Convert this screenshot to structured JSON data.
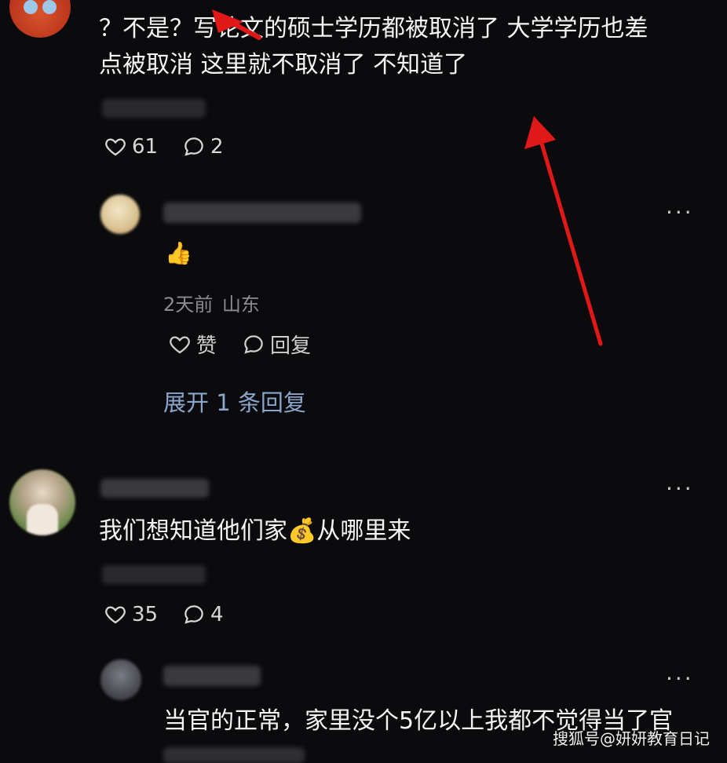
{
  "comments": [
    {
      "text_line1": "？不是？写论文的硕士学历都被取消了 大学学历也差",
      "text_line2": "点被取消 这里就不取消了 不知道了",
      "likes": "61",
      "replies": "2"
    },
    {
      "text": "我们想知道他们家💰从哪里来",
      "likes": "35",
      "replies": "4"
    }
  ],
  "reply1": {
    "emoji": "👍",
    "time": "2天前",
    "location": "山东",
    "like_label": "赞",
    "reply_label": "回复",
    "expand_label": "展开 1 条回复"
  },
  "reply2": {
    "text": "当官的正常，家里没个5亿以上我都不觉得当了官"
  },
  "more_glyph": "···",
  "watermark": "搜狐号@妍妍教育日记",
  "colors": {
    "background": "#0b0b0d",
    "arrow": "#e01818",
    "expand_link": "#8aa6cc"
  }
}
